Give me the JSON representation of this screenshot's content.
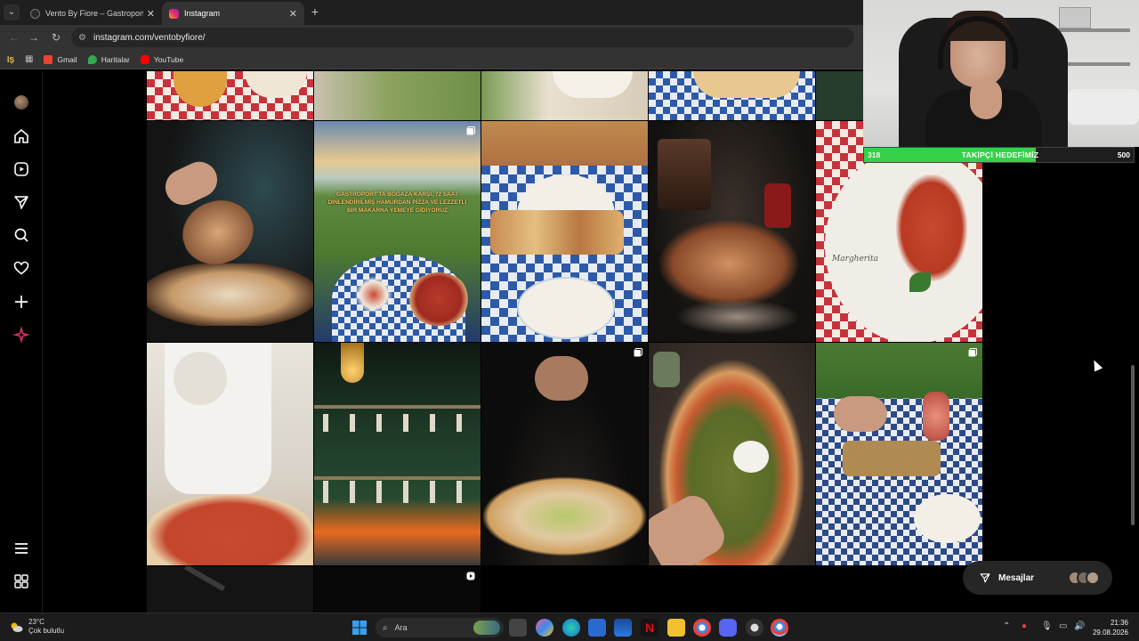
{
  "browser": {
    "tabs": [
      {
        "title": "Vento By Fiore – Gastroport Çar",
        "active": false,
        "close": "✕"
      },
      {
        "title": "Instagram",
        "active": true,
        "close": "✕"
      }
    ],
    "new_tab": "+",
    "url": "instagram.com/ventobyfiore/",
    "bookmarks": [
      {
        "label": "Gmail",
        "icon": "gmail-icon",
        "color": "#ea4335"
      },
      {
        "label": "Haritalar",
        "icon": "maps-icon",
        "color": "#34a853"
      },
      {
        "label": "YouTube",
        "icon": "youtube-icon",
        "color": "#ff0000"
      }
    ],
    "bookmarks_lead": "İŞ"
  },
  "instagram": {
    "nav": [
      "profile-avatar",
      "home-icon",
      "reels-icon",
      "messages-icon",
      "search-icon",
      "notifications-icon",
      "create-icon",
      "meta-ai-icon",
      "more-menu-icon",
      "threads-icon"
    ],
    "post_overlay_text": "GASTROPORT'TA BOĞAZA KARŞI, 72 SAAT DİNLENDİRİLMİŞ HAMURDAN PİZZA VE LEZZETLİ BİR MAKARNA YEMEYE GİDİYORUZ",
    "plate_text": "Margherita",
    "messages_label": "Mesajlar"
  },
  "stream": {
    "goal_current": "318",
    "goal_label": "TAKİPÇİ HEDEFİMİZ",
    "goal_target": "500",
    "goal_fraction": 0.636
  },
  "taskbar": {
    "temperature": "23°C",
    "weather": "Çok bulutlu",
    "search_placeholder": "Ara",
    "time": "21:36",
    "date": "29.08.2026"
  },
  "colors": {
    "accent_ig": "#e1306c",
    "goal_green": "#36d04a",
    "checker_red": "#c8323a",
    "checker_blue": "#2d5aa8"
  }
}
